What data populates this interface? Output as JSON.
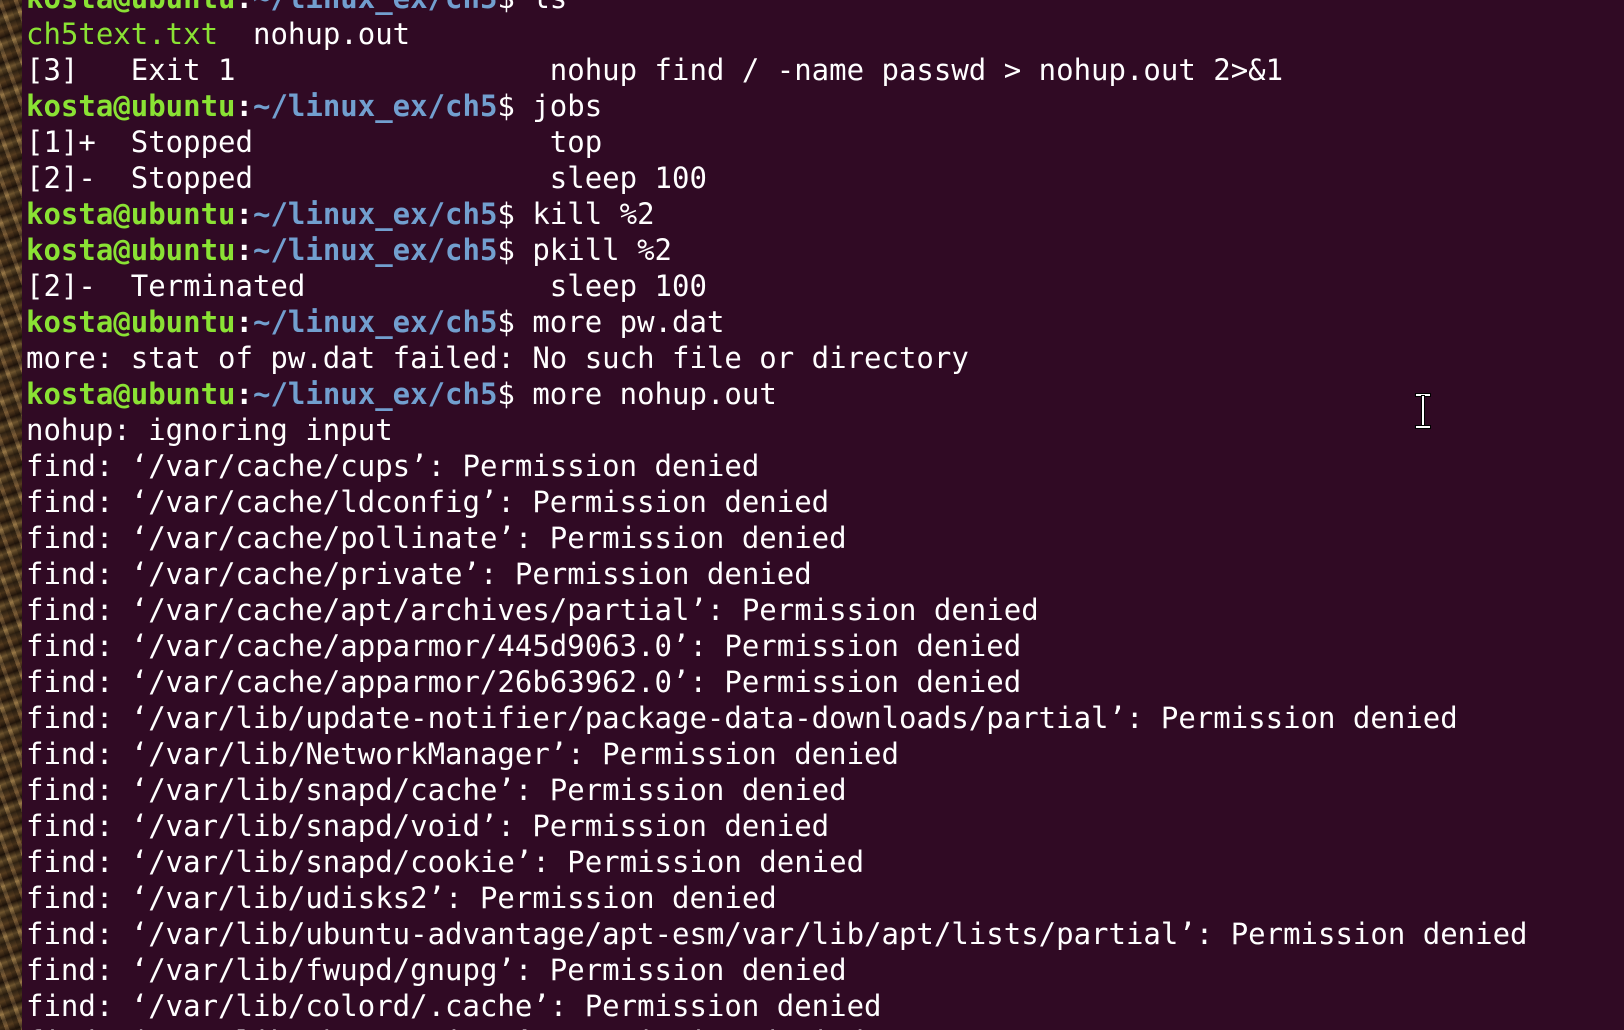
{
  "terminal": {
    "lines": [
      {
        "kind": "prompt",
        "user": "kosta@ubuntu",
        "colon": ":",
        "path": "~/linux_ex/ch5",
        "dollar": "$ ",
        "cmd": "ls"
      },
      {
        "kind": "ls",
        "file": "ch5text.txt",
        "rest": "  nohup.out"
      },
      {
        "kind": "output",
        "text": "[3]   Exit 1                  nohup find / -name passwd > nohup.out 2>&1"
      },
      {
        "kind": "prompt",
        "user": "kosta@ubuntu",
        "colon": ":",
        "path": "~/linux_ex/ch5",
        "dollar": "$ ",
        "cmd": "jobs"
      },
      {
        "kind": "output",
        "text": "[1]+  Stopped                 top"
      },
      {
        "kind": "output",
        "text": "[2]-  Stopped                 sleep 100"
      },
      {
        "kind": "prompt",
        "user": "kosta@ubuntu",
        "colon": ":",
        "path": "~/linux_ex/ch5",
        "dollar": "$ ",
        "cmd": "kill %2"
      },
      {
        "kind": "prompt",
        "user": "kosta@ubuntu",
        "colon": ":",
        "path": "~/linux_ex/ch5",
        "dollar": "$ ",
        "cmd": "pkill %2"
      },
      {
        "kind": "output",
        "text": "[2]-  Terminated              sleep 100"
      },
      {
        "kind": "prompt",
        "user": "kosta@ubuntu",
        "colon": ":",
        "path": "~/linux_ex/ch5",
        "dollar": "$ ",
        "cmd": "more pw.dat"
      },
      {
        "kind": "output",
        "text": "more: stat of pw.dat failed: No such file or directory"
      },
      {
        "kind": "prompt",
        "user": "kosta@ubuntu",
        "colon": ":",
        "path": "~/linux_ex/ch5",
        "dollar": "$ ",
        "cmd": "more nohup.out"
      },
      {
        "kind": "output",
        "text": "nohup: ignoring input"
      },
      {
        "kind": "output",
        "text": "find: ‘/var/cache/cups’: Permission denied"
      },
      {
        "kind": "output",
        "text": "find: ‘/var/cache/ldconfig’: Permission denied"
      },
      {
        "kind": "output",
        "text": "find: ‘/var/cache/pollinate’: Permission denied"
      },
      {
        "kind": "output",
        "text": "find: ‘/var/cache/private’: Permission denied"
      },
      {
        "kind": "output",
        "text": "find: ‘/var/cache/apt/archives/partial’: Permission denied"
      },
      {
        "kind": "output",
        "text": "find: ‘/var/cache/apparmor/445d9063.0’: Permission denied"
      },
      {
        "kind": "output",
        "text": "find: ‘/var/cache/apparmor/26b63962.0’: Permission denied"
      },
      {
        "kind": "output",
        "text": "find: ‘/var/lib/update-notifier/package-data-downloads/partial’: Permission denied"
      },
      {
        "kind": "output",
        "text": "find: ‘/var/lib/NetworkManager’: Permission denied"
      },
      {
        "kind": "output",
        "text": "find: ‘/var/lib/snapd/cache’: Permission denied"
      },
      {
        "kind": "output",
        "text": "find: ‘/var/lib/snapd/void’: Permission denied"
      },
      {
        "kind": "output",
        "text": "find: ‘/var/lib/snapd/cookie’: Permission denied"
      },
      {
        "kind": "output",
        "text": "find: ‘/var/lib/udisks2’: Permission denied"
      },
      {
        "kind": "output",
        "text": "find: ‘/var/lib/ubuntu-advantage/apt-esm/var/lib/apt/lists/partial’: Permission denied"
      },
      {
        "kind": "output",
        "text": "find: ‘/var/lib/fwupd/gnupg’: Permission denied"
      },
      {
        "kind": "output",
        "text": "find: ‘/var/lib/colord/.cache’: Permission denied"
      },
      {
        "kind": "output",
        "text": "find: ‘/var/lib/php/sessions’: Permission denied"
      }
    ]
  },
  "cursor": {
    "icon": "text-cursor-icon"
  },
  "colors": {
    "background": "#300a24",
    "prompt_user": "#8ae234",
    "prompt_path": "#729fcf",
    "text": "#ffffff"
  }
}
